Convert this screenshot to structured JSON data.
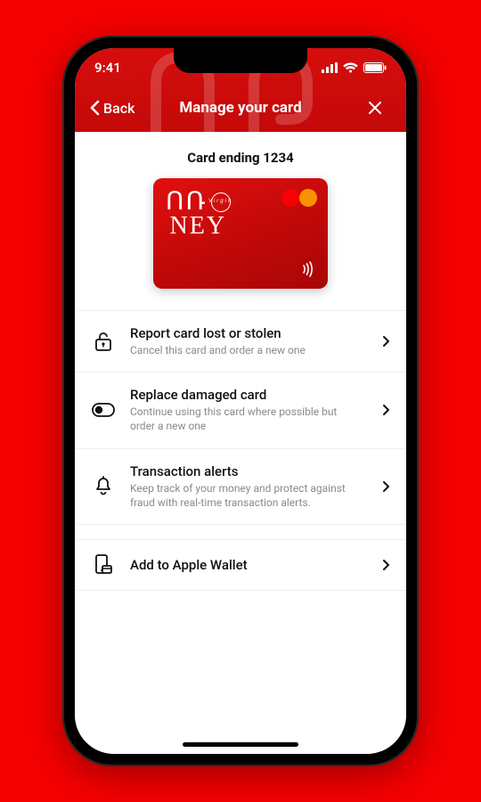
{
  "status": {
    "time": "9:41"
  },
  "nav": {
    "back_label": "Back",
    "title": "Manage your card"
  },
  "card": {
    "title": "Card ending 1234",
    "brand_line1": "ՈՌՕ",
    "brand_line2": "NEY",
    "brand_badge": "Virgin"
  },
  "actions": {
    "lost": {
      "label": "Report card lost or stolen",
      "sub": "Cancel this card and order a new one"
    },
    "replace": {
      "label": "Replace damaged card",
      "sub": "Continue using this card where possible but order a new one"
    },
    "alerts": {
      "label": "Transaction alerts",
      "sub": "Keep track of your money and protect against fraud with real-time transaction alerts."
    },
    "wallet": {
      "label": "Add to Apple Wallet"
    }
  }
}
